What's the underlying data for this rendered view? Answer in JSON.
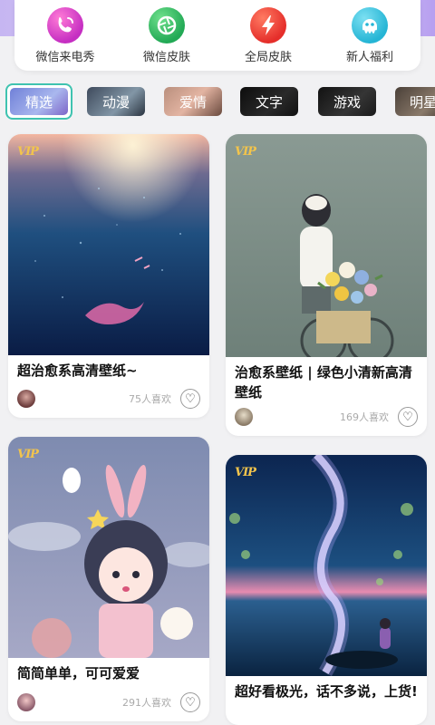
{
  "shortcuts": [
    {
      "label": "微信来电秀",
      "icon": "phone-call-icon"
    },
    {
      "label": "微信皮肤",
      "icon": "camera-shutter-icon"
    },
    {
      "label": "全局皮肤",
      "icon": "lightning-icon"
    },
    {
      "label": "新人福利",
      "icon": "octopus-gift-icon"
    }
  ],
  "tabs": [
    {
      "label": "精选",
      "selected": true
    },
    {
      "label": "动漫"
    },
    {
      "label": "爱情"
    },
    {
      "label": "文字"
    },
    {
      "label": "游戏"
    },
    {
      "label": "明星"
    }
  ],
  "cards": [
    {
      "title": "超治愈系高清壁纸~",
      "likes": "75人喜欢",
      "badge": "VIP",
      "scene": "underwater"
    },
    {
      "title": "治愈系壁纸 | 绿色小清新高清壁纸",
      "likes": "169人喜欢",
      "badge": "VIP",
      "scene": "bicycle-girl"
    },
    {
      "title": "简简单单，可可爱爱",
      "likes": "291人喜欢",
      "badge": "VIP",
      "scene": "bunny-girl"
    },
    {
      "title": "超好看极光，话不多说，上货!",
      "likes": "",
      "badge": "VIP",
      "scene": "aurora"
    }
  ],
  "colors": {
    "accent": "#3fc3b0",
    "vip": "#f2c44c"
  }
}
